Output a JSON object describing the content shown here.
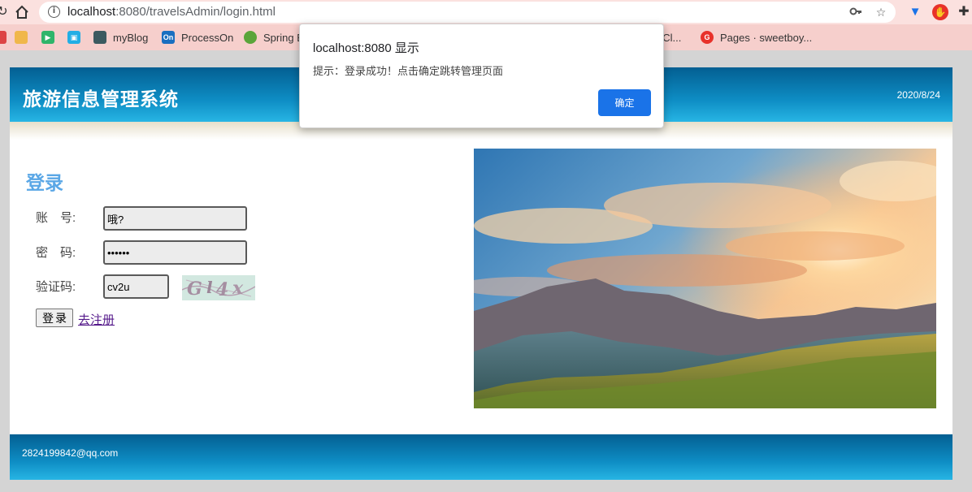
{
  "browser": {
    "url_host": "localhost",
    "url_rest": ":8080/travelsAdmin/login.html",
    "bookmarks": [
      {
        "label": "myBlog",
        "color": "#3c5a60",
        "icon": "blog-icon"
      },
      {
        "label": "ProcessOn",
        "color": "#1a6fc0",
        "icon": "processon-icon",
        "mark": "On"
      },
      {
        "label": "Spring B",
        "color": "#5aa53a",
        "icon": "spring-icon"
      },
      {
        "label": "nCl...",
        "color": "#888888",
        "icon": "bookmark-icon"
      },
      {
        "label": "Pages · sweetboy...",
        "color": "#e8312a",
        "icon": "gitee-icon",
        "mark": "G"
      }
    ]
  },
  "site": {
    "title": "旅游信息管理系统",
    "date": "2020/8/24",
    "footer_email": "2824199842@qq.com"
  },
  "login": {
    "title": "登录",
    "account_label": "账　号:",
    "account_value": "哦?",
    "password_label": "密　码:",
    "password_value": "••••••",
    "captcha_label": "验证码:",
    "captcha_value": "cv2u",
    "submit_label": "登录",
    "register_link": "去注册"
  },
  "dialog": {
    "title": "localhost:8080 显示",
    "message": "提示：登录成功！点击确定跳转管理页面",
    "ok_label": "确定"
  }
}
